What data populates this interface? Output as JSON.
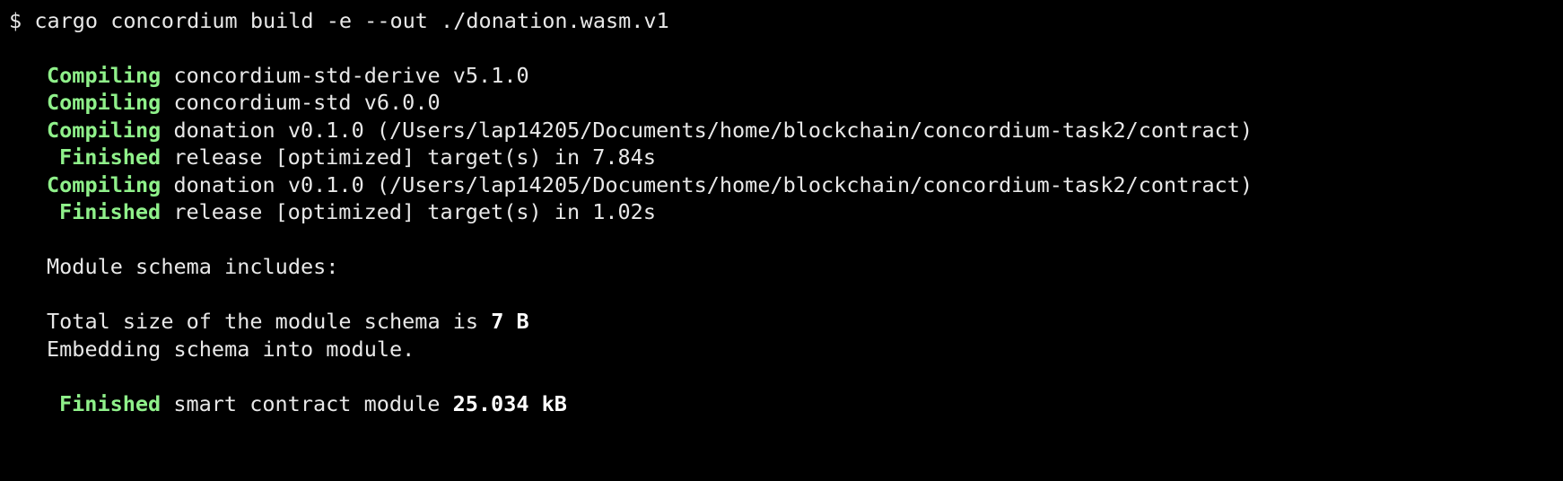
{
  "terminal": {
    "prompt_symbol": "$",
    "command": "cargo concordium build -e --out ./donation.wasm.v1",
    "output": [
      {
        "kind": "status",
        "label": "Compiling",
        "text": "concordium-std-derive v5.1.0"
      },
      {
        "kind": "status",
        "label": "Compiling",
        "text": "concordium-std v6.0.0"
      },
      {
        "kind": "status",
        "label": "Compiling",
        "text": "donation v0.1.0 (/Users/lap14205/Documents/home/blockchain/concordium-task2/contract)"
      },
      {
        "kind": "status",
        "label": "Finished",
        "text": "release [optimized] target(s) in 7.84s"
      },
      {
        "kind": "status",
        "label": "Compiling",
        "text": "donation v0.1.0 (/Users/lap14205/Documents/home/blockchain/concordium-task2/contract)"
      },
      {
        "kind": "status",
        "label": "Finished",
        "text": "release [optimized] target(s) in 1.02s"
      }
    ],
    "schema_heading": "Module schema includes:",
    "schema_size_prefix": "Total size of the module schema is ",
    "schema_size_value": "7 B",
    "embedding_text": "Embedding schema into module.",
    "final_label": "Finished",
    "final_text": "smart contract module ",
    "final_size": "25.034 kB"
  },
  "colors": {
    "background": "#000000",
    "text": "#e8e8e8",
    "status_green": "#8ff08a",
    "highlight": "#ffffff"
  }
}
